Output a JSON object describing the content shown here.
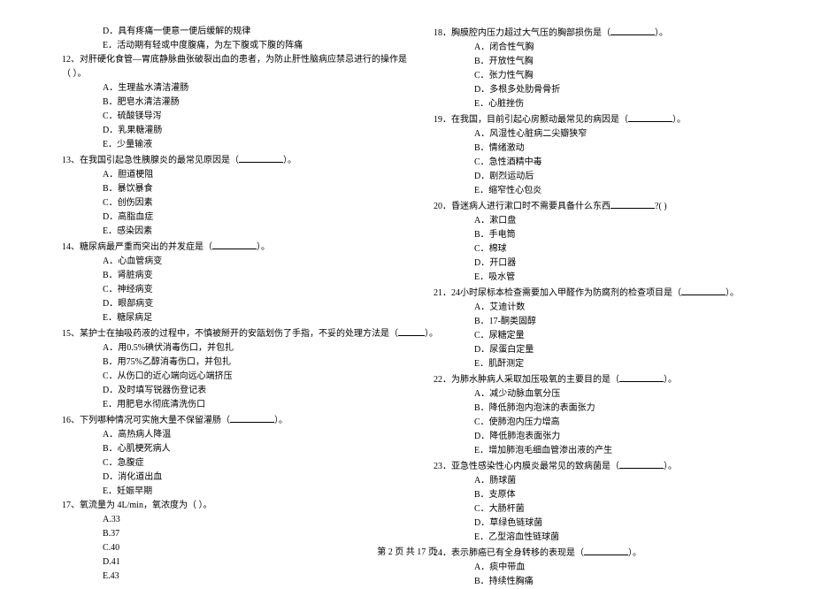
{
  "left": {
    "pre_opts": [
      "D．具有疼痛一便意一便后缓解的规律",
      "E．活动期有轻或中度腹痛，为左下腹或下腹的阵痛"
    ],
    "q12": {
      "stem_a": "12、对肝硬化食管—胃底静脉曲张破裂出血的患者，为防止肝性脑病应禁忌进行的操作是",
      "stem_b": "（         ）。",
      "opts": [
        "A．生理盐水清洁灌肠",
        "B．肥皂水清洁灌肠",
        "C．硫酸镁导泻",
        "D．乳果糖灌肠",
        "E．少量输液"
      ]
    },
    "q13": {
      "stem": "13、在我国引起急性胰腺炎的最常见原因是（",
      "tail": "）。",
      "opts": [
        "A．胆道梗阻",
        "B．暴饮暴食",
        "C．创伤因素",
        "D．高脂血症",
        "E．感染因素"
      ]
    },
    "q14": {
      "stem": "14、糖尿病最严重而突出的并发症是（",
      "tail": "）。",
      "opts": [
        "A．心血管病变",
        "B．肾脏病变",
        "C．神经病变",
        "D．眼部病变",
        "E．糖尿病足"
      ]
    },
    "q15": {
      "stem": "15、某护士在抽吸药液的过程中，不慎被掰开的安瓿划伤了手指，不妥的处理方法是（",
      "tail": "）。",
      "opts": [
        "A．用0.5%碘伏消毒伤口，并包扎",
        "B．用75%乙醇消毒伤口，并包扎",
        "C．从伤口的近心端向远心端挤压",
        "D．及时填写锐器伤登记表",
        "E．用肥皂水彻底清洗伤口"
      ]
    },
    "q16": {
      "stem": "16、下列哪种情况可实施大量不保留灌肠（",
      "tail": "）。",
      "opts": [
        "A．高热病人降温",
        "B．心肌梗死病人",
        "C．急腹症",
        "D．消化道出血",
        "E．妊娠早期"
      ]
    },
    "q17": {
      "stem": "17、氧流量为 4L/min，氧浓度为（        ）。",
      "opts": [
        "A.33",
        "B.37",
        "C.40",
        "D.41",
        "E.43"
      ]
    }
  },
  "right": {
    "q18": {
      "stem": "18．胸膜腔内压力超过大气压的胸部损伤是（",
      "tail": "）。",
      "opts": [
        "A．闭合性气胸",
        "B．开放性气胸",
        "C．张力性气胸",
        "D．多根多处肋骨骨折",
        "E．心脏挫伤"
      ]
    },
    "q19": {
      "stem": "19．在我国，目前引起心房颤动最常见的病因是（",
      "tail": "）。",
      "opts": [
        "A．风湿性心脏病二尖瓣狭窄",
        "B．情绪激动",
        "C．急性酒精中毒",
        "D．剧烈运动后",
        "E．缩窄性心包炎"
      ]
    },
    "q20": {
      "stem": "20．昏迷病人进行漱口时不需要具备什么东西",
      "tail": "?(          )",
      "opts": [
        "A．漱口盘",
        "B．手电筒",
        "C．棉球",
        "D．开口器",
        "E．吸水管"
      ]
    },
    "q21": {
      "stem": "21．24小时尿标本检查需要加入甲醛作为防腐剂的检查项目是（",
      "tail": "）。",
      "opts": [
        "A．艾迪计数",
        "B．17-酮类固醇",
        "C．尿糖定量",
        "D．尿蛋白定量",
        "E．肌酐测定"
      ]
    },
    "q22": {
      "stem": "22．为肺水肿病人采取加压吸氧的主要目的是（",
      "tail": "）。",
      "opts": [
        "A．减少动脉血氧分压",
        "B．降低肺泡内泡沫的表面张力",
        "C．使肺泡内压力增高",
        "D．降低肺泡表面张力",
        "E．增加肺泡毛细血管渗出液的产生"
      ]
    },
    "q23": {
      "stem": "23．亚急性感染性心内膜炎最常见的致病菌是（",
      "tail": "）。",
      "opts": [
        "A．肠球菌",
        "B．支原体",
        "C．大肠杆菌",
        "D．草绿色链球菌",
        "E．乙型溶血性链球菌"
      ]
    },
    "q24": {
      "stem": "24．表示肺癌已有全身转移的表现是（",
      "tail": "）。",
      "opts": [
        "A．痰中带血",
        "B．持续性胸痛"
      ]
    }
  },
  "footer": "第 2 页 共 17 页"
}
